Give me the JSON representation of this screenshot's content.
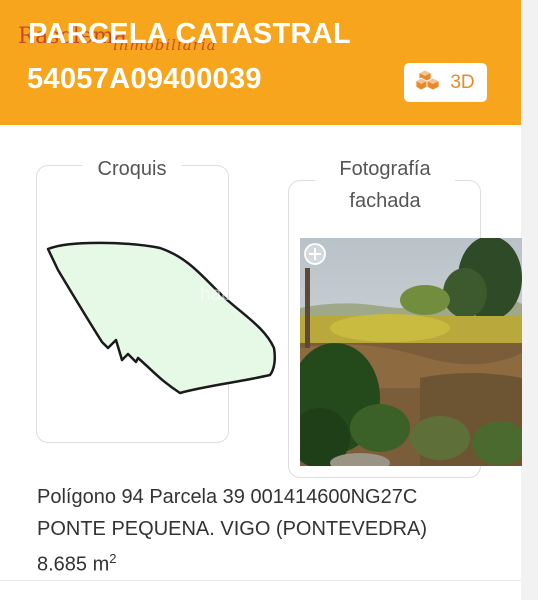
{
  "header": {
    "title": "PARCELA CATASTRAL",
    "reference": "54057A09400039",
    "watermark_brand": "Rasolema",
    "watermark_sub": "inmobiliaria",
    "btn_3d_label": "3D",
    "btn_3d_icon": "cubes-icon"
  },
  "sketch": {
    "label": "Croquis",
    "fill_color": "#e6f8e6"
  },
  "photo": {
    "label_line1": "Fotografía",
    "label_line2": "fachada",
    "watermark": "habitaclia",
    "zoom_icon": "plus-icon"
  },
  "info": {
    "line1": "Polígono 94 Parcela 39 001414600NG27C",
    "line2": "PONTE PEQUENA. VIGO (PONTEVEDRA)",
    "area_value": "8.685 m",
    "area_unit_sup": "2"
  },
  "colors": {
    "header_bg": "#f7a51c",
    "accent": "#e8892b"
  }
}
